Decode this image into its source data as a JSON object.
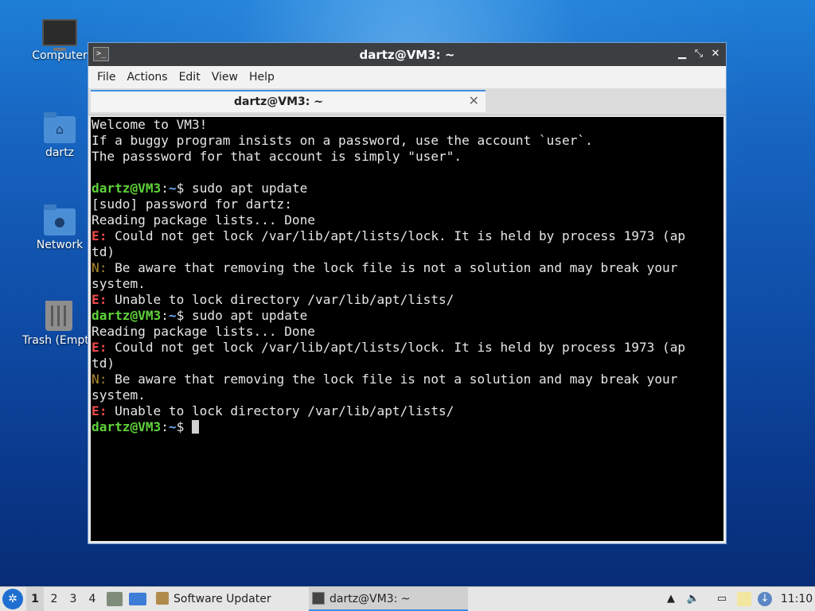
{
  "desktop": {
    "icons": [
      {
        "label": "Computer"
      },
      {
        "label": "dartz"
      },
      {
        "label": "Network"
      },
      {
        "label": "Trash (Empty)"
      }
    ]
  },
  "window": {
    "title": "dartz@VM3: ~",
    "controls": {
      "minimize": "▁",
      "maximize": "⤡",
      "close": "✕"
    },
    "menu": [
      "File",
      "Actions",
      "Edit",
      "View",
      "Help"
    ],
    "tab": {
      "label": "dartz@VM3: ~",
      "close": "✕"
    }
  },
  "terminal": {
    "lines": [
      {
        "type": "text",
        "text": "Welcome to VM3!"
      },
      {
        "type": "text",
        "text": "If a buggy program insists on a password, use the account `user`."
      },
      {
        "type": "text",
        "text": "The passsword for that account is simply \"user\"."
      },
      {
        "type": "text",
        "text": ""
      },
      {
        "type": "prompt",
        "user": "dartz@VM3",
        "sep": ":",
        "path": "~",
        "sym": "$ ",
        "cmd": "sudo apt update"
      },
      {
        "type": "text",
        "text": "[sudo] password for dartz:"
      },
      {
        "type": "text",
        "text": "Reading package lists... Done"
      },
      {
        "type": "msg",
        "tag": "E:",
        "kind": "err",
        "text": " Could not get lock /var/lib/apt/lists/lock. It is held by process 1973 (ap"
      },
      {
        "type": "text",
        "text": "td)"
      },
      {
        "type": "msg",
        "tag": "N:",
        "kind": "note",
        "text": " Be aware that removing the lock file is not a solution and may break your"
      },
      {
        "type": "text",
        "text": "system."
      },
      {
        "type": "msg",
        "tag": "E:",
        "kind": "err",
        "text": " Unable to lock directory /var/lib/apt/lists/"
      },
      {
        "type": "prompt",
        "user": "dartz@VM3",
        "sep": ":",
        "path": "~",
        "sym": "$ ",
        "cmd": "sudo apt update"
      },
      {
        "type": "text",
        "text": "Reading package lists... Done"
      },
      {
        "type": "msg",
        "tag": "E:",
        "kind": "err",
        "text": " Could not get lock /var/lib/apt/lists/lock. It is held by process 1973 (ap"
      },
      {
        "type": "text",
        "text": "td)"
      },
      {
        "type": "msg",
        "tag": "N:",
        "kind": "note",
        "text": " Be aware that removing the lock file is not a solution and may break your"
      },
      {
        "type": "text",
        "text": "system."
      },
      {
        "type": "msg",
        "tag": "E:",
        "kind": "err",
        "text": " Unable to lock directory /var/lib/apt/lists/"
      },
      {
        "type": "prompt",
        "user": "dartz@VM3",
        "sep": ":",
        "path": "~",
        "sym": "$ ",
        "cmd": "",
        "cursor": true
      }
    ]
  },
  "taskbar": {
    "workspaces": [
      "1",
      "2",
      "3",
      "4"
    ],
    "active_workspace": "1",
    "tasks": [
      {
        "label": "Software Updater",
        "icon": "package-icon",
        "active": false
      },
      {
        "label": "dartz@VM3: ~",
        "icon": "terminal-icon",
        "active": true
      }
    ],
    "clock": "11:10"
  },
  "colors": {
    "prompt_user": "#5ed33a",
    "prompt_path": "#6fa8f5",
    "error_tag": "#ef4a4a",
    "note_tag": "#b0882e",
    "accent": "#3d8ee3"
  }
}
